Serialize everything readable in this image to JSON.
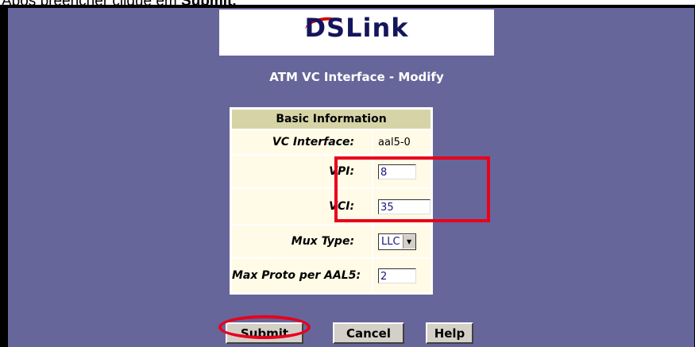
{
  "caption": {
    "text": "Após preencher clique em ",
    "emphasis": "Submit."
  },
  "logo": {
    "text": "DSLink"
  },
  "page": {
    "heading": "ATM VC Interface - Modify"
  },
  "form": {
    "section_header": "Basic Information",
    "vc_interface": {
      "label": "VC Interface:",
      "value": "aal5-0"
    },
    "vpi": {
      "label": "VPI:",
      "value": "8"
    },
    "vci": {
      "label": "VCI:",
      "value": "35"
    },
    "mux_type": {
      "label": "Mux Type:",
      "value": "LLC"
    },
    "max_proto": {
      "label": "Max Proto per AAL5:",
      "value": "2"
    }
  },
  "buttons": {
    "submit": "Submit",
    "cancel": "Cancel",
    "help": "Help"
  },
  "colors": {
    "background": "#66669a",
    "highlight": "#e8001c",
    "table_header": "#d6d4a7"
  }
}
